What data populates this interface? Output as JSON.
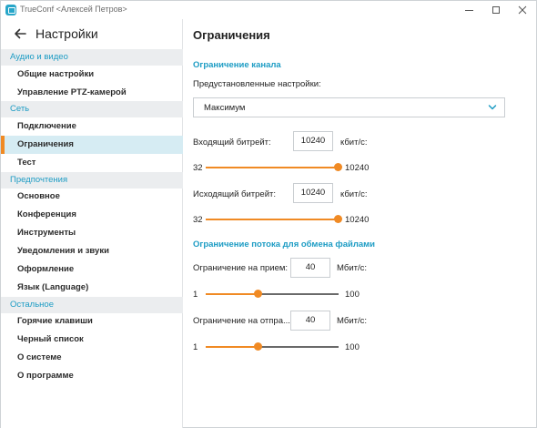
{
  "window": {
    "title": "TrueConf <Алексей Петров>"
  },
  "sidebar": {
    "title": "Настройки",
    "sections": [
      {
        "label": "Аудио и видео",
        "items": [
          "Общие настройки",
          "Управление PTZ-камерой"
        ]
      },
      {
        "label": "Сеть",
        "items": [
          "Подключение",
          "Ограничения",
          "Тест"
        ]
      },
      {
        "label": "Предпочтения",
        "items": [
          "Основное",
          "Конференция",
          "Инструменты",
          "Уведомления и звуки",
          "Оформление",
          "Язык (Language)"
        ]
      },
      {
        "label": "Остальное",
        "items": [
          "Горячие клавиши",
          "Черный список",
          "О системе",
          "О программе"
        ]
      }
    ],
    "active_item": "Ограничения"
  },
  "main": {
    "title": "Ограничения",
    "channel": {
      "heading": "Ограничение канала",
      "preset_label": "Предустановленные настройки:",
      "preset_value": "Максимум",
      "incoming": {
        "label": "Входящий битрейт:",
        "value": "10240",
        "unit": "кбит/с:",
        "min": "32",
        "max": "10240",
        "level": 1.0
      },
      "outgoing": {
        "label": "Исходящий битрейт:",
        "value": "10240",
        "unit": "кбит/с:",
        "min": "32",
        "max": "10240",
        "level": 1.0
      }
    },
    "files": {
      "heading": "Ограничение потока для обмена файлами",
      "receive": {
        "label": "Ограничение на прием:",
        "value": "40",
        "unit": "Мбит/с:",
        "min": "1",
        "max": "100",
        "level": 0.39
      },
      "send": {
        "label": "Ограничение на отпра...",
        "value": "40",
        "unit": "Мбит/с:",
        "min": "1",
        "max": "100",
        "level": 0.39
      }
    }
  },
  "colors": {
    "accent": "#f08a24",
    "link": "#1d9cc4",
    "active_bg": "#d6ecf3",
    "section_bg": "#ebedef"
  }
}
